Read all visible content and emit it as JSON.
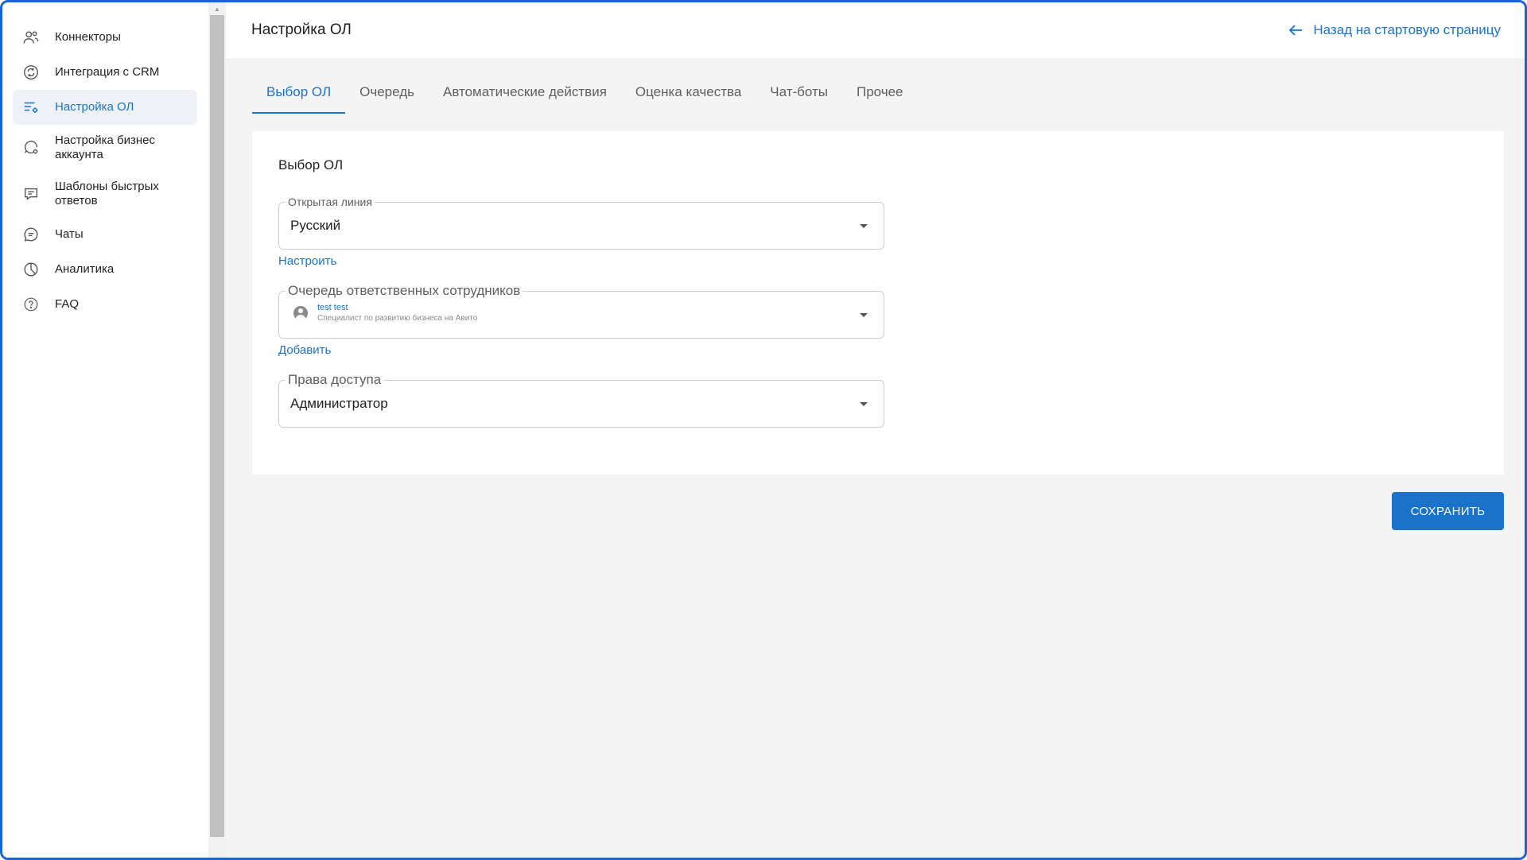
{
  "sidebar": {
    "items": [
      {
        "label": "Коннекторы",
        "icon": "connectors-icon",
        "active": false
      },
      {
        "label": "Интеграция с CRM",
        "icon": "sync-icon",
        "active": false
      },
      {
        "label": "Настройка ОЛ",
        "icon": "list-settings-icon",
        "active": true
      },
      {
        "label": "Настройка бизнес аккаунта",
        "icon": "business-account-icon",
        "active": false
      },
      {
        "label": "Шаблоны быстрых ответов",
        "icon": "message-template-icon",
        "active": false
      },
      {
        "label": "Чаты",
        "icon": "chat-icon",
        "active": false
      },
      {
        "label": "Аналитика",
        "icon": "pie-chart-icon",
        "active": false
      },
      {
        "label": "FAQ",
        "icon": "help-circle-icon",
        "active": false
      }
    ]
  },
  "header": {
    "title": "Настройка ОЛ",
    "back_link": "Назад на стартовую страницу"
  },
  "tabs": [
    {
      "label": "Выбор ОЛ",
      "active": true
    },
    {
      "label": "Очередь",
      "active": false
    },
    {
      "label": "Автоматические действия",
      "active": false
    },
    {
      "label": "Оценка качества",
      "active": false
    },
    {
      "label": "Чат-боты",
      "active": false
    },
    {
      "label": "Прочее",
      "active": false
    }
  ],
  "card": {
    "title": "Выбор ОЛ",
    "open_line": {
      "label": "Открытая линия",
      "value": "Русский",
      "link": "Настроить"
    },
    "queue": {
      "label": "Очередь ответственных сотрудников",
      "person_name": "test test",
      "person_role": "Специалист по развитию бизнеса на Авито",
      "link": "Добавить"
    },
    "access": {
      "label": "Права доступа",
      "value": "Администратор"
    }
  },
  "actions": {
    "save_label": "СОХРАНИТЬ"
  },
  "colors": {
    "accent": "#1a73c8",
    "frame": "#1565d8",
    "background": "#f4f4f4"
  }
}
